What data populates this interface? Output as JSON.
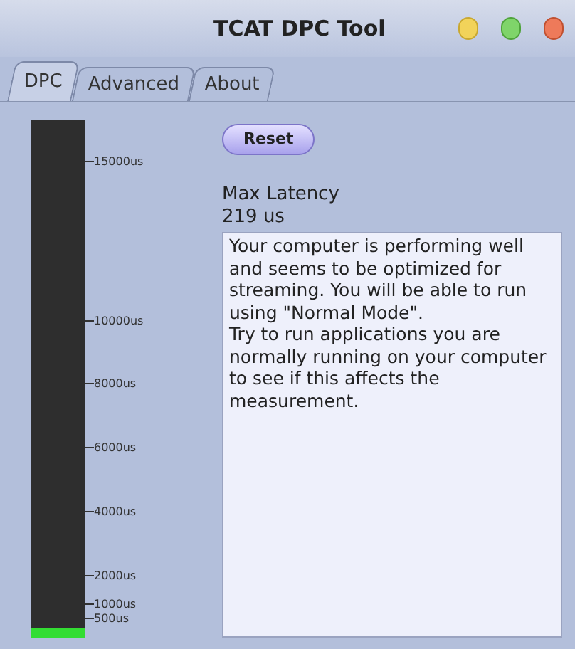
{
  "window": {
    "title": "TCAT DPC Tool"
  },
  "tabs": [
    {
      "label": "DPC",
      "selected": true
    },
    {
      "label": "Advanced",
      "selected": false
    },
    {
      "label": "About",
      "selected": false
    }
  ],
  "meter": {
    "level": 0.02,
    "ticks": [
      "15000us",
      "10000us",
      "8000us",
      "6000us",
      "4000us",
      "2000us",
      "1000us",
      "500us"
    ]
  },
  "reset_button": "Reset",
  "max_latency": {
    "label": "Max Latency",
    "value": "219 us"
  },
  "message": "Your computer is performing well and seems to be optimized for streaming. You will be able to run using \"Normal Mode\".\nTry to run applications you are normally running on your computer to see if this affects the measurement."
}
